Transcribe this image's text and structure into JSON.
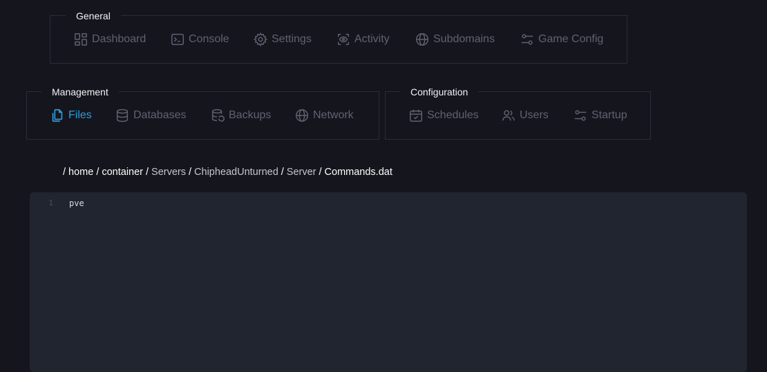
{
  "groups": {
    "general": {
      "legend": "General",
      "items": [
        "Dashboard",
        "Console",
        "Settings",
        "Activity",
        "Subdomains",
        "Game Config"
      ]
    },
    "management": {
      "legend": "Management",
      "items": [
        "Files",
        "Databases",
        "Backups",
        "Network"
      ]
    },
    "configuration": {
      "legend": "Configuration",
      "items": [
        "Schedules",
        "Users",
        "Startup"
      ]
    }
  },
  "active_item": "Files",
  "breadcrumb": [
    "home",
    "container",
    "Servers",
    "ChipheadUnturned",
    "Server",
    "Commands.dat"
  ],
  "editor": {
    "lines": [
      {
        "number": "1",
        "text": "pve"
      }
    ]
  },
  "colors": {
    "accent": "#2a9fe0",
    "inactive": "#5f6370",
    "background": "#15151d",
    "editor_bg": "#212530"
  }
}
